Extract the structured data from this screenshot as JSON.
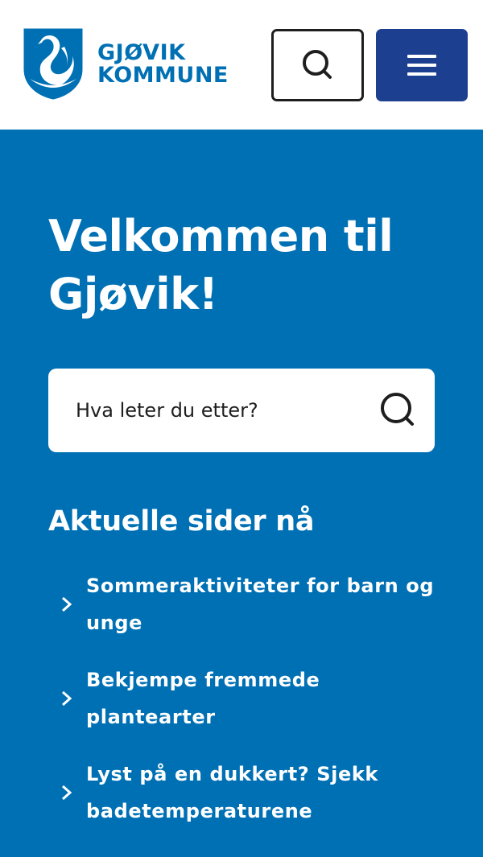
{
  "header": {
    "logo": {
      "line1": "GJØVIK",
      "line2": "KOMMUNE"
    },
    "search_icon": "search-icon",
    "menu_icon": "menu-icon",
    "brand_color": "#0070b4",
    "menu_button_color": "#1c3f8f"
  },
  "hero": {
    "title_line1": "Velkommen til",
    "title_line2": "Gjøvik!",
    "search": {
      "placeholder": "Hva leter du etter?",
      "icon": "search-icon"
    }
  },
  "popular": {
    "heading": "Aktuelle sider nå",
    "links": [
      {
        "label": "Sommeraktiviteter for barn og unge",
        "icon": "chevron-right-icon"
      },
      {
        "label": "Bekjempe fremmede plantearter",
        "icon": "chevron-right-icon"
      },
      {
        "label": "Lyst på en dukkert? Sjekk badetemperaturene",
        "icon": "chevron-right-icon"
      }
    ]
  }
}
